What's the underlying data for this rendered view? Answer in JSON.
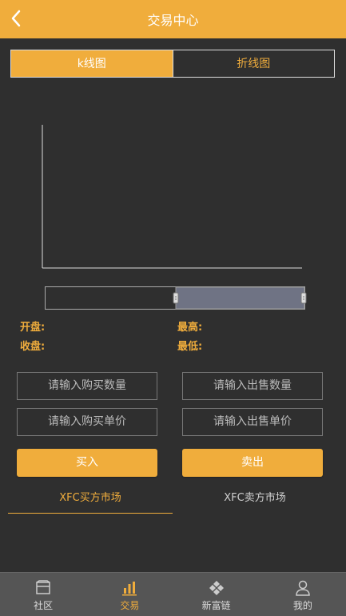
{
  "header": {
    "title": "交易中心"
  },
  "tabs": {
    "kline": "k线图",
    "line": "折线图"
  },
  "stats": {
    "open": "开盘:",
    "close": "收盘:",
    "high": "最高:",
    "low": "最低:"
  },
  "buy": {
    "quantity_placeholder": "请输入购买数量",
    "price_placeholder": "请输入购买单价",
    "button": "买入"
  },
  "sell": {
    "quantity_placeholder": "请输入出售数量",
    "price_placeholder": "请输入出售单价",
    "button": "卖出"
  },
  "market_tabs": {
    "buy": "XFC买方市场",
    "sell": "XFC卖方市场"
  },
  "nav": {
    "items": [
      {
        "label": "社区",
        "icon": "community-icon"
      },
      {
        "label": "交易",
        "icon": "chart-icon"
      },
      {
        "label": "新富链",
        "icon": "chain-icon"
      },
      {
        "label": "我的",
        "icon": "user-icon"
      }
    ]
  },
  "colors": {
    "accent": "#f0ad3c",
    "background": "#2f2f2f",
    "nav_background": "#555555"
  }
}
